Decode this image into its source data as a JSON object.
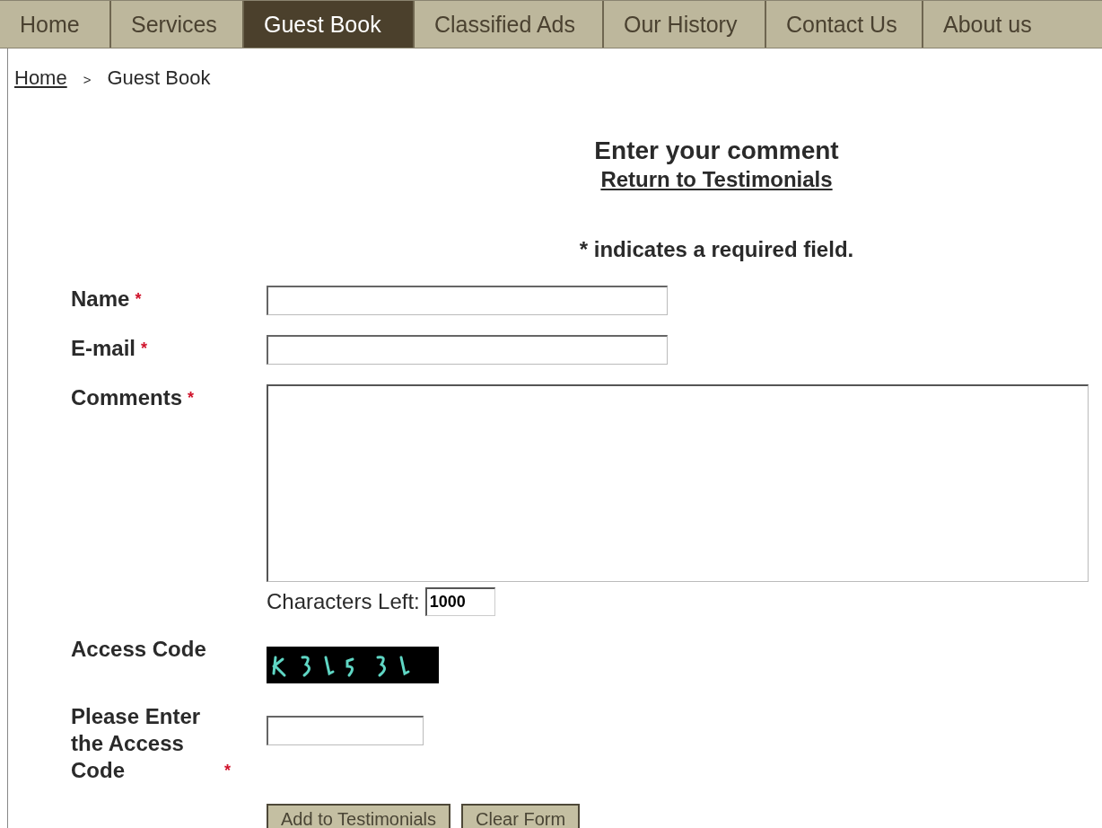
{
  "nav": {
    "tabs": [
      {
        "label": "Home",
        "selected": false
      },
      {
        "label": "Services",
        "selected": false
      },
      {
        "label": "Guest Book",
        "selected": true
      },
      {
        "label": "Classified Ads",
        "selected": false
      },
      {
        "label": "Our History",
        "selected": false
      },
      {
        "label": "Contact Us",
        "selected": false
      },
      {
        "label": "About us",
        "selected": false
      }
    ]
  },
  "breadcrumb": [
    {
      "label": "Home",
      "kind": "link"
    },
    {
      "label": ">",
      "kind": "separator"
    },
    {
      "label": "Guest Book",
      "kind": "current"
    }
  ],
  "heading": "Enter your comment",
  "return_link": "Return to Testimonials",
  "required_note": "* indicates a required field.",
  "required_mark": "*",
  "fields": [
    {
      "label": "Name",
      "required": true,
      "kind": "text"
    },
    {
      "label": "E-mail",
      "required": true,
      "kind": "text"
    },
    {
      "label": "Comments",
      "required": true,
      "kind": "textarea",
      "counter": {
        "label": "Characters Left:",
        "value": "1000"
      }
    },
    {
      "label": "Access Code",
      "required": false,
      "kind": "captcha"
    },
    {
      "label": "Please Enter the Access Code",
      "required": true,
      "kind": "code"
    }
  ],
  "buttons": [
    "Add to Testimonials",
    "Clear Form"
  ]
}
